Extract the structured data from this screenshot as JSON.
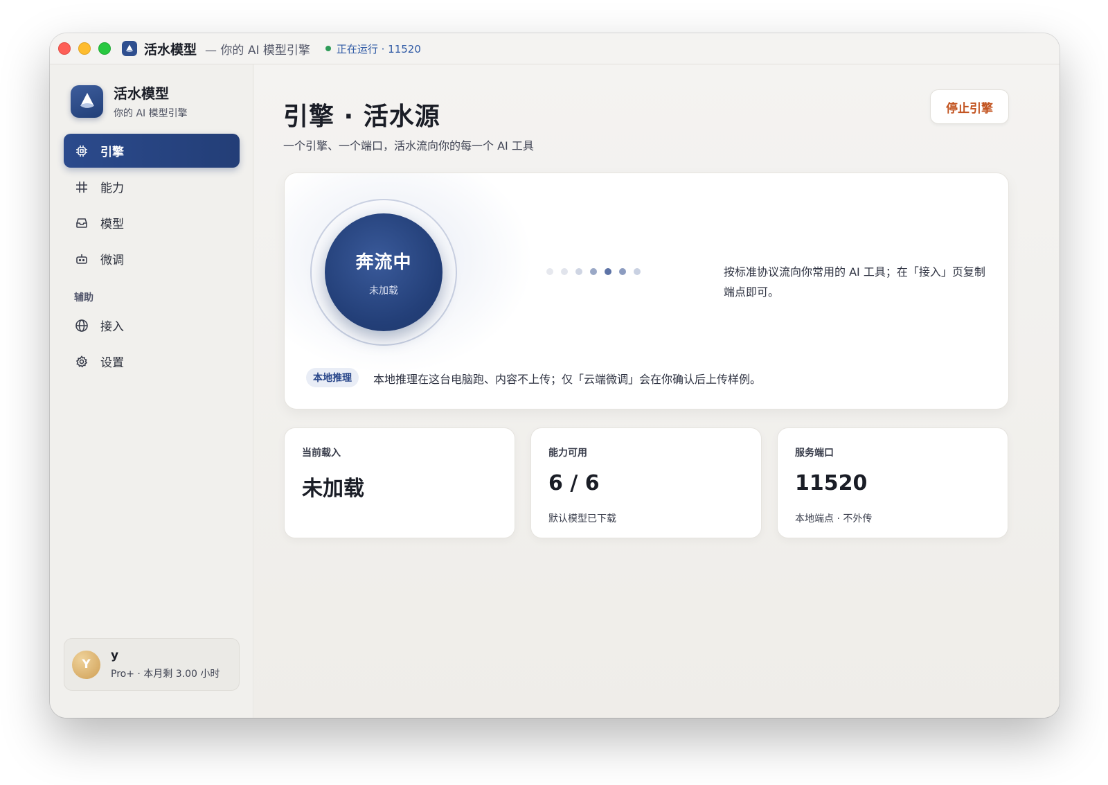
{
  "titlebar": {
    "app_name": "活水模型",
    "subtitle": "— 你的 AI 模型引擎",
    "status": "正在运行 · 11520",
    "colors": {
      "close": "#fe5f57",
      "minimize": "#febc2e",
      "zoom": "#28c840",
      "status_dot": "#2e9b58"
    }
  },
  "sidebar": {
    "brand_name": "活水模型",
    "brand_sub": "你的 AI 模型引擎",
    "items": [
      {
        "label": "引擎",
        "icon": "chip-icon",
        "active": true
      },
      {
        "label": "能力",
        "icon": "hash-icon",
        "active": false
      },
      {
        "label": "模型",
        "icon": "inbox-icon",
        "active": false
      },
      {
        "label": "微调",
        "icon": "robot-icon",
        "active": false
      }
    ],
    "section_label": "辅助",
    "aux_items": [
      {
        "label": "接入",
        "icon": "globe-icon"
      },
      {
        "label": "设置",
        "icon": "gear-icon"
      }
    ],
    "user": {
      "avatar_letter": "Y",
      "name": "y",
      "plan": "Pro+ · 本月剩 3.00 小时"
    }
  },
  "main": {
    "title": "引擎 · 活水源",
    "subtitle": "一个引擎、一个端口，活水流向你的每一个 AI 工具",
    "stop_button": "停止引擎",
    "accent_color": "#233e77",
    "hero": {
      "core_title": "奔流中",
      "core_sub": "未加载",
      "description": "按标准协议流向你常用的 AI 工具；在「接入」页复制端点即可。",
      "badge": "本地推理",
      "note": "本地推理在这台电脑跑、内容不上传；仅「云端微调」会在你确认后上传样例。"
    },
    "stats": [
      {
        "label": "当前载入",
        "value": "未加载",
        "note": ""
      },
      {
        "label": "能力可用",
        "value": "6 / 6",
        "note": "默认模型已下载"
      },
      {
        "label": "服务端口",
        "value": "11520",
        "note": "本地端点 · 不外传"
      }
    ]
  }
}
